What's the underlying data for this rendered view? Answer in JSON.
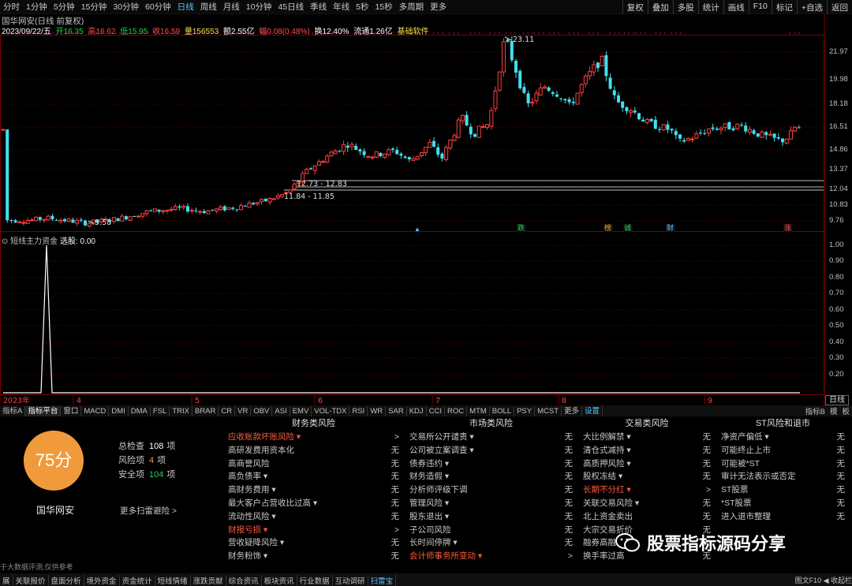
{
  "periods": [
    "分时",
    "1分钟",
    "5分钟",
    "15分钟",
    "30分钟",
    "60分钟",
    "日线",
    "周线",
    "月线",
    "10分钟",
    "45日线",
    "季线",
    "年线",
    "5秒",
    "15秒",
    "多周期",
    "更多"
  ],
  "active_period": "日线",
  "right_buttons": [
    "复权",
    "叠加",
    "多股",
    "统计",
    "画线",
    "F10",
    "标记",
    "+自选",
    "返回"
  ],
  "stock_title": "国华网安(日线 前复权)",
  "info": {
    "date": "2023/09/22/五",
    "open": "开16.35",
    "high": "高16.62",
    "low": "低15.95",
    "close": "收16.59",
    "volume": "量156553",
    "amount": "额2.55亿",
    "change": "幅0.08(0.48%)",
    "turnover": "换12.40%",
    "float": "流通1.26亿",
    "software": "基础软件"
  },
  "axis_prices": [
    "21.97",
    "19.98",
    "18.18",
    "16.51",
    "14.86",
    "13.37",
    "12.04",
    "10.83",
    "9.76"
  ],
  "annotations": {
    "high": "23.11",
    "low": "9.58",
    "band1": "12.73 - 12.83",
    "band2": "11.84 - 11.85"
  },
  "event_markers": [
    {
      "label": "跌",
      "color": "#23d14b"
    },
    {
      "label": "榜",
      "color": "#f0a020"
    },
    {
      "label": "诚",
      "color": "#23d14b"
    },
    {
      "label": "财",
      "color": "#59c7ff"
    },
    {
      "label": "涨",
      "color": "#ff4d4d"
    }
  ],
  "indicator": {
    "name": "短线主力资金",
    "value": "选股: 0.00",
    "axis": [
      "1.00",
      "0.90",
      "0.80",
      "0.70",
      "0.60",
      "0.50",
      "0.40",
      "0.30",
      "0.20"
    ]
  },
  "x_axis_labels": [
    "2023年",
    "4",
    "5",
    "6",
    "7",
    "8",
    "9"
  ],
  "daily_box": "日线",
  "tabs": [
    "指标A",
    "指标平台",
    "窗口",
    "MACD",
    "DMI",
    "DMA",
    "FSL",
    "TRIX",
    "BRAR",
    "CR",
    "VR",
    "OBV",
    "ASI",
    "EMV",
    "VOL-TDX",
    "RSI",
    "WR",
    "SAR",
    "KDJ",
    "CCI",
    "ROC",
    "MTM",
    "BOLL",
    "PSY",
    "MCST",
    "更多",
    "设置"
  ],
  "active_tab": "设置",
  "tabs_right": [
    "指标B",
    "模",
    "板"
  ],
  "panel": {
    "score": "75分",
    "stock_name": "国华网安",
    "summary": [
      {
        "label": "总检查",
        "value": "108",
        "unit": "项",
        "style": ""
      },
      {
        "label": "风险项",
        "value": "4",
        "unit": "项",
        "style": "o"
      },
      {
        "label": "安全项",
        "value": "104",
        "unit": "项",
        "style": "g"
      }
    ],
    "more": "更多扫雷避险 >",
    "columns": [
      {
        "title": "财务类风险",
        "rows": [
          {
            "name": "应收账款坏账风险 ▾",
            "status": ">",
            "warn": true
          },
          {
            "name": "高研发费用资本化",
            "status": "无",
            "warn": false
          },
          {
            "name": "高商誉风险",
            "status": "无",
            "warn": false
          },
          {
            "name": "高负债率 ▾",
            "status": "无",
            "warn": false
          },
          {
            "name": "高财务费用 ▾",
            "status": "无",
            "warn": false
          },
          {
            "name": "最大客户占营收比过高 ▾",
            "status": "无",
            "warn": false
          },
          {
            "name": "流动性风险 ▾",
            "status": "无",
            "warn": false
          },
          {
            "name": "财报亏损 ▾",
            "status": ">",
            "warn": true
          },
          {
            "name": "营收疑降风险 ▾",
            "status": "无",
            "warn": false
          },
          {
            "name": "财务粉饰 ▾",
            "status": "无",
            "warn": false
          }
        ]
      },
      {
        "title": "市场类风险",
        "rows": [
          {
            "name": "交易所公开谴责 ▾",
            "status": "无",
            "warn": false
          },
          {
            "name": "公司被立案调查 ▾",
            "status": "无",
            "warn": false
          },
          {
            "name": "债券违约 ▾",
            "status": "无",
            "warn": false
          },
          {
            "name": "财务造假 ▾",
            "status": "无",
            "warn": false
          },
          {
            "name": "分析师评级下调",
            "status": "无",
            "warn": false
          },
          {
            "name": "管理风险 ▾",
            "status": "无",
            "warn": false
          },
          {
            "name": "股东退出 ▾",
            "status": "无",
            "warn": false
          },
          {
            "name": "子公司风险",
            "status": "无",
            "warn": false
          },
          {
            "name": "长时间停牌 ▾",
            "status": "无",
            "warn": false
          },
          {
            "name": "会计师事务所变动 ▾",
            "status": ">",
            "warn": true
          }
        ]
      },
      {
        "title": "交易类风险",
        "rows": [
          {
            "name": "大比例解禁 ▾",
            "status": "无",
            "warn": false
          },
          {
            "name": "清仓式减持 ▾",
            "status": "无",
            "warn": false
          },
          {
            "name": "高质押风险 ▾",
            "status": "无",
            "warn": false
          },
          {
            "name": "股权冻结 ▾",
            "status": "无",
            "warn": false
          },
          {
            "name": "长期不分红 ▾",
            "status": ">",
            "warn": true
          },
          {
            "name": "关联交易风险 ▾",
            "status": "无",
            "warn": false
          },
          {
            "name": "北上资金卖出",
            "status": "无",
            "warn": false
          },
          {
            "name": "大宗交易折价",
            "status": "无",
            "warn": false
          },
          {
            "name": "融券高融",
            "status": "无",
            "warn": false
          },
          {
            "name": "换手率过高",
            "status": "无",
            "warn": false
          }
        ]
      },
      {
        "title": "ST风险和退市",
        "rows": [
          {
            "name": "净资产偏低 ▾",
            "status": "无",
            "warn": false
          },
          {
            "name": "可能终止上市",
            "status": "无",
            "warn": false
          },
          {
            "name": "可能被*ST",
            "status": "无",
            "warn": false
          },
          {
            "name": "审计无法表示或否定",
            "status": "无",
            "warn": false
          },
          {
            "name": "ST股票",
            "status": "无",
            "warn": false
          },
          {
            "name": "*ST股票",
            "status": "无",
            "warn": false
          },
          {
            "name": "进入退市整理",
            "status": "无",
            "warn": false
          }
        ]
      }
    ]
  },
  "disclaimer": "于大数据评测,仅供参考",
  "bottom_tabs": [
    "展",
    "关联报价",
    "盘面分析",
    "境外资金",
    "资金统计",
    "短线情绪",
    "涨跌贡献",
    "综合资讯",
    "板块资讯",
    "行业数据",
    "互动调研",
    "扫雷宝"
  ],
  "bottom_active": "扫雷宝",
  "bottom_right": "图文F10 ◀ 收起栏",
  "watermark": "股票指标源码分享"
}
